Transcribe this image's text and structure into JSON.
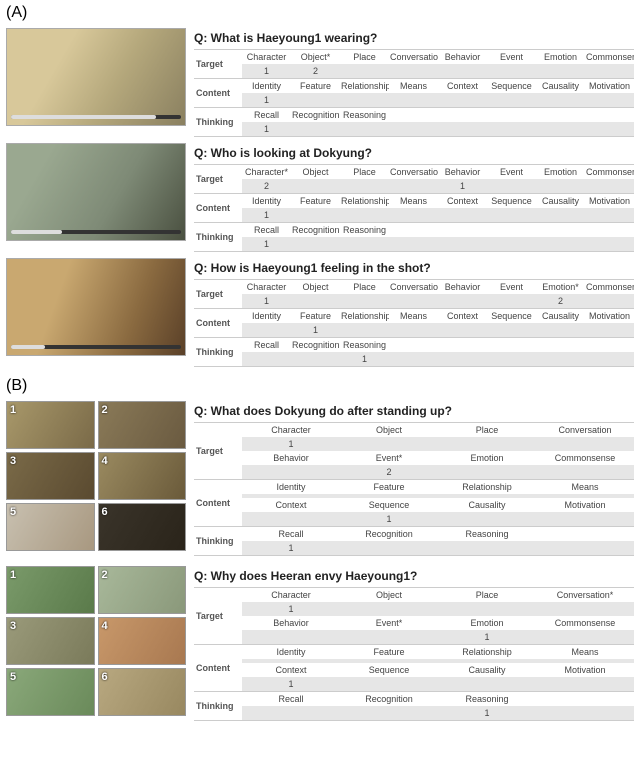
{
  "sectionA": "(A)",
  "sectionB": "(B)",
  "targetLabel": "Target",
  "contentLabel": "Content",
  "thinkingLabel": "Thinking",
  "targetHeaders8": [
    "Character",
    "Object",
    "Place",
    "Conversation",
    "Behavior",
    "Event",
    "Emotion",
    "Commonsense"
  ],
  "targetHeaders8_charStar": [
    "Character*",
    "Object",
    "Place",
    "Conversation",
    "Behavior",
    "Event",
    "Emotion",
    "Commonsense"
  ],
  "targetHeaders8_objStar": [
    "Character",
    "Object*",
    "Place",
    "Conversation",
    "Behavior",
    "Event",
    "Emotion",
    "Commonsense"
  ],
  "targetHeaders8_emoStar": [
    "Character",
    "Object",
    "Place",
    "Conversation",
    "Behavior",
    "Event",
    "Emotion*",
    "Commonsense"
  ],
  "targetHeadersA": [
    "Character",
    "Object",
    "Place",
    "Conversation"
  ],
  "targetHeadersB_evStar": [
    "Behavior",
    "Event*",
    "Emotion",
    "Commonsense"
  ],
  "targetHeadersA_convStar": [
    "Character",
    "Object",
    "Place",
    "Conversation*"
  ],
  "contentHeaders8": [
    "Identity",
    "Feature",
    "Relationship",
    "Means",
    "Context",
    "Sequence",
    "Causality",
    "Motivation"
  ],
  "contentHeadersA": [
    "Identity",
    "Feature",
    "Relationship",
    "Means"
  ],
  "contentHeadersB": [
    "Context",
    "Sequence",
    "Causality",
    "Motivation"
  ],
  "thinkingHeaders3": [
    "Recall",
    "Recognition",
    "Reasoning"
  ],
  "A1": {
    "q": "Q: What is Haeyoung1 wearing?",
    "targetVals": [
      "1",
      "2",
      "",
      "",
      "",
      "",
      "",
      ""
    ],
    "contentVals": [
      "1",
      "",
      "",
      "",
      "",
      "",
      "",
      ""
    ],
    "thinkingVals": [
      "1",
      "",
      ""
    ],
    "progress": "85%"
  },
  "A2": {
    "q": "Q: Who is looking at Dokyung?",
    "targetVals": [
      "2",
      "",
      "",
      "",
      "1",
      "",
      "",
      ""
    ],
    "contentVals": [
      "1",
      "",
      "",
      "",
      "",
      "",
      "",
      ""
    ],
    "thinkingVals": [
      "1",
      "",
      ""
    ],
    "progress": "30%"
  },
  "A3": {
    "q": "Q: How is Haeyoung1 feeling in the shot?",
    "targetVals": [
      "1",
      "",
      "",
      "",
      "",
      "",
      "2",
      ""
    ],
    "contentVals": [
      "",
      "1",
      "",
      "",
      "",
      "",
      "",
      ""
    ],
    "thinkingVals": [
      "",
      "",
      "1"
    ],
    "progress": "20%"
  },
  "B1": {
    "q": "Q: What does Dokyung do after standing up?",
    "targetValsA": [
      "1",
      "",
      "",
      ""
    ],
    "targetValsB": [
      "",
      "2",
      "",
      ""
    ],
    "contentValsA": [
      "",
      "",
      "",
      ""
    ],
    "contentValsB": [
      "",
      "1",
      "",
      ""
    ],
    "thinkingVals": [
      "1",
      "",
      ""
    ],
    "thumbs": [
      "1",
      "2",
      "3",
      "4",
      "5",
      "6"
    ]
  },
  "B2": {
    "q": "Q: Why does Heeran envy Haeyoung1?",
    "targetValsA": [
      "1",
      "",
      "",
      ""
    ],
    "targetValsB": [
      "",
      "",
      "1",
      ""
    ],
    "contentValsA": [
      "",
      "",
      "",
      ""
    ],
    "contentValsB": [
      "1",
      "",
      "",
      ""
    ],
    "thinkingVals": [
      "",
      "",
      "1"
    ],
    "thumbs": [
      "1",
      "2",
      "3",
      "4",
      "5",
      "6"
    ]
  }
}
